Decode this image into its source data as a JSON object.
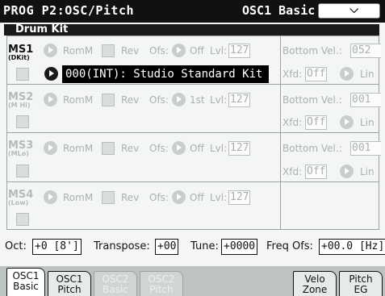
{
  "header": {
    "mode": "PROG P2:OSC/Pitch",
    "oscillator": "OSC1 Basic",
    "menu_icon": "chevron-down-icon"
  },
  "drum_kit": {
    "title": "Drum Kit",
    "kit_name": "000(INT): Studio Standard Kit",
    "samples": [
      {
        "label": "MS1",
        "sub": "(DKit)",
        "rom": "RomM",
        "rev": "Rev",
        "ofs_label": "Ofs:",
        "ofs_value": "Off",
        "lvl_label": "Lvl:",
        "lvl_value": "127",
        "bottom_label": "Bottom Vel.:",
        "bottom_value": "052",
        "xfd_label": "Xfd:",
        "xfd_value": "Off",
        "curve": "Lin"
      },
      {
        "label": "MS2",
        "sub": "(M Hi)",
        "rom": "RomM",
        "rev": "Rev",
        "ofs_label": "Ofs:",
        "ofs_value": "1st",
        "lvl_label": "Lvl:",
        "lvl_value": "127",
        "bottom_label": "Bottom Vel.:",
        "bottom_value": "001",
        "xfd_label": "Xfd:",
        "xfd_value": "Off",
        "curve": "Lin"
      },
      {
        "label": "MS3",
        "sub": "(MLo)",
        "rom": "RomM",
        "rev": "Rev",
        "ofs_label": "Ofs:",
        "ofs_value": "Off",
        "lvl_label": "Lvl:",
        "lvl_value": "127",
        "bottom_label": "Bottom Vel.:",
        "bottom_value": "001",
        "xfd_label": "Xfd:",
        "xfd_value": "Off",
        "curve": "Lin"
      },
      {
        "label": "MS4",
        "sub": "(Low)",
        "rom": "RomM",
        "rev": "Rev",
        "ofs_label": "Ofs:",
        "ofs_value": "Off",
        "lvl_label": "Lvl:",
        "lvl_value": "127"
      }
    ]
  },
  "params": {
    "oct_label": "Oct:",
    "oct_value": "+0 [8']",
    "transpose_label": "Transpose:",
    "transpose_value": "+00",
    "tune_label": "Tune:",
    "tune_value": "+0000",
    "freq_label": "Freq Ofs:",
    "freq_value": "+00.0 [Hz]"
  },
  "tabs": [
    {
      "line1": "OSC1",
      "line2": "Basic",
      "state": "active"
    },
    {
      "line1": "OSC1",
      "line2": "Pitch",
      "state": "inactive"
    },
    {
      "line1": "OSC2",
      "line2": "Basic",
      "state": "disabled"
    },
    {
      "line1": "OSC2",
      "line2": "Pitch",
      "state": "disabled"
    },
    {
      "line1": "Velo",
      "line2": "Zone",
      "state": "inactive"
    },
    {
      "line1": "Pitch",
      "line2": "EG",
      "state": "inactive"
    }
  ]
}
